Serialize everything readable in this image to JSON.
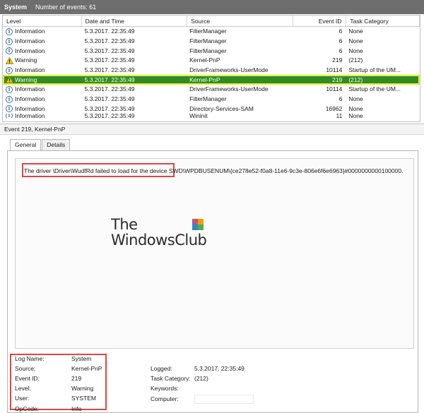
{
  "titlebar": {
    "log_name": "System",
    "count_label": "Number of events: 61"
  },
  "columns": {
    "level": "Level",
    "date": "Date and Time",
    "source": "Source",
    "event_id": "Event ID",
    "task": "Task Category"
  },
  "rows": [
    {
      "icon": "info-icon",
      "level": "Information",
      "date": "5.3.2017. 22:35:49",
      "source": "FilterManager",
      "event_id": "6",
      "task": "None"
    },
    {
      "icon": "info-icon",
      "level": "Information",
      "date": "5.3.2017. 22:35:49",
      "source": "FilterManager",
      "event_id": "6",
      "task": "None"
    },
    {
      "icon": "info-icon",
      "level": "Information",
      "date": "5.3.2017. 22:35:49",
      "source": "FilterManager",
      "event_id": "6",
      "task": "None"
    },
    {
      "icon": "warning-icon",
      "level": "Warning",
      "date": "5.3.2017. 22:35:49",
      "source": "Kernel-PnP",
      "event_id": "219",
      "task": "(212)"
    },
    {
      "icon": "info-icon",
      "level": "Information",
      "date": "5.3.2017. 22:35:49",
      "source": "DriverFrameworks-UserMode",
      "event_id": "10114",
      "task": "Startup of the UM..."
    },
    {
      "icon": "warning-icon",
      "level": "Warning",
      "date": "5.3.2017. 22:35:49",
      "source": "Kernel-PnP",
      "event_id": "219",
      "task": "(212)"
    },
    {
      "icon": "info-icon",
      "level": "Information",
      "date": "5.3.2017. 22:35:49",
      "source": "DriverFrameworks-UserMode",
      "event_id": "10114",
      "task": "Startup of the UM..."
    },
    {
      "icon": "info-icon",
      "level": "Information",
      "date": "5.3.2017. 22:35:49",
      "source": "FilterManager",
      "event_id": "6",
      "task": "None"
    },
    {
      "icon": "info-icon",
      "level": "Information",
      "date": "5.3.2017. 22:35:49",
      "source": "Directory-Services-SAM",
      "event_id": "16962",
      "task": "None"
    },
    {
      "icon": "info-icon",
      "level": "Information",
      "date": "5.3.2017. 22:35:49",
      "source": "Wininit",
      "event_id": "11",
      "task": "None"
    }
  ],
  "selected_row": 5,
  "details": {
    "title": "Event 219, Kernel-PnP",
    "tabs": {
      "general": "General",
      "details": "Details"
    },
    "description": "The driver \\Driver\\WudfRd failed to load for the device SWD\\WPDBUSENUM\\{ce278e52-f0a8-11e6-9c3e-806e6f6e6963}#0000000000100000.",
    "watermark": {
      "line1": "The",
      "line2": "WindowsClub"
    },
    "props": {
      "log_name_label": "Log Name:",
      "log_name": "System",
      "source_label": "Source:",
      "source": "Kernel-PnP",
      "event_id_label": "Event ID:",
      "event_id": "219",
      "level_label": "Level:",
      "level": "Warning",
      "user_label": "User:",
      "user": "SYSTEM",
      "opcode_label": "OpCode:",
      "opcode": "Info",
      "logged_label": "Logged:",
      "logged": "5.3.2017. 22:35:49",
      "task_category_label": "Task Category:",
      "task_category": "(212)",
      "keywords_label": "Keywords:",
      "keywords": "",
      "computer_label": "Computer:",
      "computer": ""
    }
  },
  "colors": {
    "selected_bg": "#2e8c2a",
    "selected_outline": "#e8f020",
    "highlight_box": "#e04545",
    "titlebar_bg": "#6e6e6e"
  }
}
